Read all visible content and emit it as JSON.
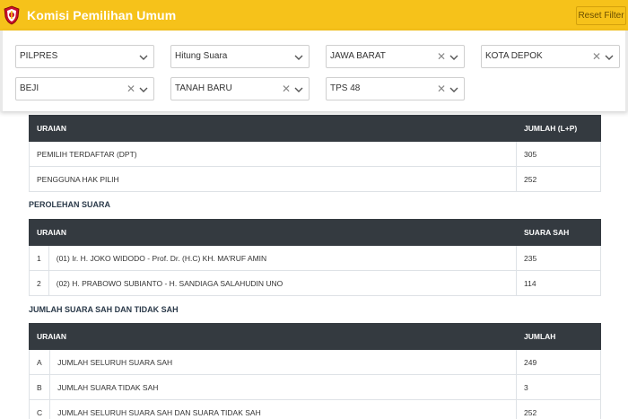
{
  "header": {
    "title": "Komisi Pemilihan Umum",
    "reset_label": "Reset Filter"
  },
  "filters": {
    "election": "PILPRES",
    "mode": "Hitung Suara",
    "province": "JAWA BARAT",
    "city": "KOTA DEPOK",
    "district": "BEJI",
    "village": "TANAH BARU",
    "tps": "TPS 48"
  },
  "voters": {
    "col_label": "URAIAN",
    "col_value": "JUMLAH (L+P)",
    "rows": [
      {
        "label": "PEMILIH TERDAFTAR (DPT)",
        "value": "305"
      },
      {
        "label": "PENGGUNA HAK PILIH",
        "value": "252"
      }
    ]
  },
  "votes": {
    "section_title": "PEROLEHAN SUARA",
    "col_label": "URAIAN",
    "col_value": "SUARA SAH",
    "rows": [
      {
        "no": "1",
        "label": "(01) Ir. H. JOKO WIDODO - Prof. Dr. (H.C) KH. MA'RUF AMIN",
        "value": "235"
      },
      {
        "no": "2",
        "label": "(02) H. PRABOWO SUBIANTO - H. SANDIAGA SALAHUDIN UNO",
        "value": "114"
      }
    ]
  },
  "totals": {
    "section_title": "JUMLAH SUARA SAH DAN TIDAK SAH",
    "col_label": "URAIAN",
    "col_value": "JUMLAH",
    "rows": [
      {
        "no": "A",
        "label": "JUMLAH SELURUH SUARA SAH",
        "value": "249"
      },
      {
        "no": "B",
        "label": "JUMLAH SUARA TIDAK SAH",
        "value": "3"
      },
      {
        "no": "C",
        "label": "JUMLAH SELURUH SUARA SAH DAN SUARA TIDAK SAH",
        "value": "252"
      }
    ]
  },
  "colors": {
    "brand": "#f6c21a",
    "table_header": "#343a40"
  }
}
